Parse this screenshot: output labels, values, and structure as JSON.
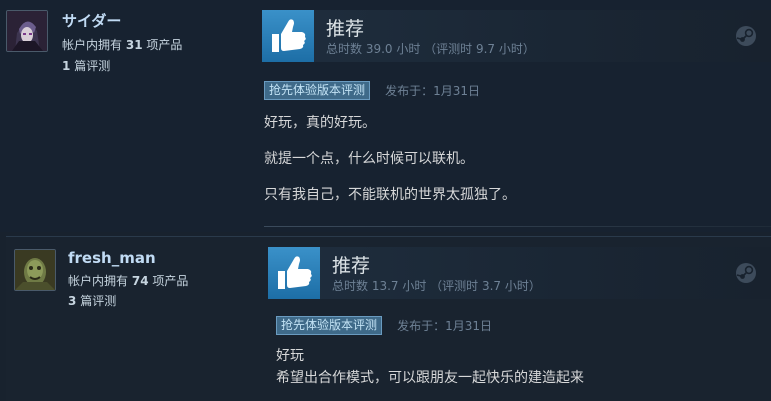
{
  "reviews": [
    {
      "author": {
        "name": "サイダー",
        "products_prefix": "帐户内拥有",
        "products_count": "31",
        "products_suffix": "项产品",
        "reviews_count": "1",
        "reviews_suffix": "篇评测"
      },
      "vote": {
        "label": "推荐",
        "hours": "总时数 39.0 小时 （评测时 9.7 小时）"
      },
      "badge": "抢先体验版本评测",
      "posted": "发布于：1月31日",
      "paragraphs": [
        "好玩，真的好玩。",
        "就提一个点，什么时候可以联机。",
        "只有我自己，不能联机的世界太孤独了。"
      ]
    },
    {
      "author": {
        "name": "fresh_man",
        "products_prefix": "帐户内拥有",
        "products_count": "74",
        "products_suffix": "项产品",
        "reviews_count": "3",
        "reviews_suffix": "篇评测"
      },
      "vote": {
        "label": "推荐",
        "hours": "总时数 13.7 小时 （评测时 3.7 小时）"
      },
      "badge": "抢先体验版本评测",
      "posted": "发布于：1月31日",
      "paragraphs": [
        "好玩",
        "希望出合作模式，可以跟朋友一起快乐的建造起来"
      ]
    }
  ],
  "icons": {
    "thumb": "thumbs-up-icon",
    "steam": "steam-logo-icon"
  },
  "colors": {
    "accent": "#3a91c9",
    "name": "#c1dbf4",
    "badge_bg": "#3f6a89"
  }
}
